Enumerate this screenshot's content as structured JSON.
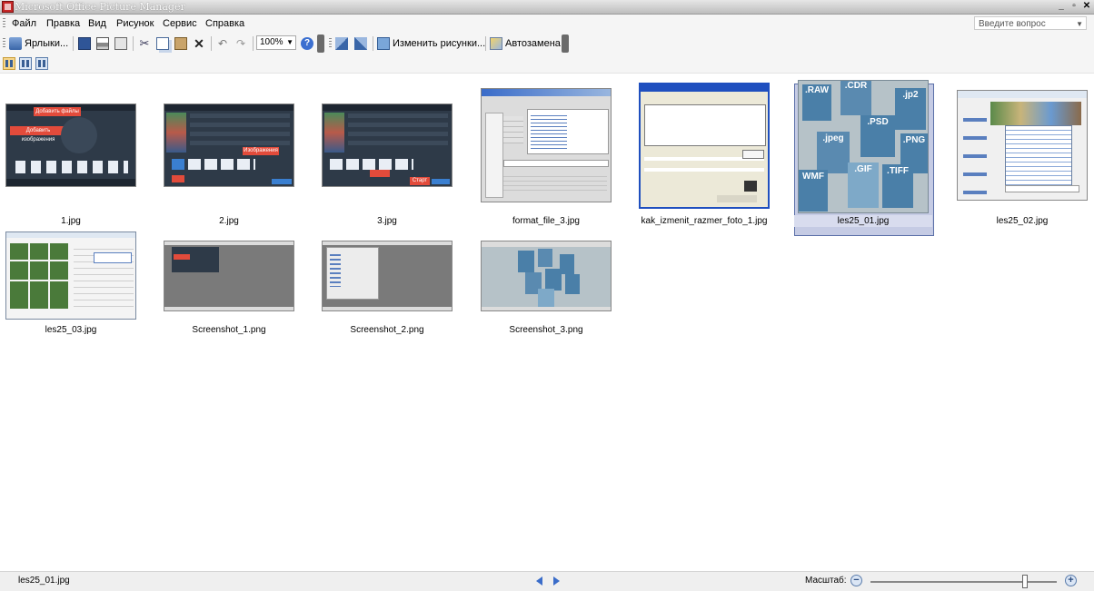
{
  "window": {
    "title": "Microsoft Office Picture Manager"
  },
  "menu": {
    "items": [
      "Файл",
      "Правка",
      "Вид",
      "Рисунок",
      "Сервис",
      "Справка"
    ]
  },
  "help": {
    "placeholder": "Введите вопрос"
  },
  "toolbar": {
    "shortcuts_label": "Ярлыки...",
    "zoom_value": "100%",
    "edit_pictures_label": "Изменить рисунки...",
    "autocorrect_label": "Автозамена"
  },
  "gallery": {
    "thumbnails": [
      {
        "filename": "1.jpg"
      },
      {
        "filename": "2.jpg"
      },
      {
        "filename": "3.jpg"
      },
      {
        "filename": "format_file_3.jpg"
      },
      {
        "filename": "kak_izmenit_razmer_foto_1.jpg"
      },
      {
        "filename": "les25_01.jpg",
        "selected": true
      },
      {
        "filename": "les25_02.jpg"
      },
      {
        "filename": "les25_03.jpg"
      },
      {
        "filename": "Screenshot_1.png"
      },
      {
        "filename": "Screenshot_2.png"
      },
      {
        "filename": "Screenshot_3.png"
      }
    ],
    "format_tags": [
      ".RAW",
      ".CDR",
      ".jp2",
      ".PSD",
      ".jpeg",
      ".PNG",
      "WMF",
      ".GIF",
      ".TIFF"
    ],
    "thumb_texts": {
      "t1_a": "Добавить файлы",
      "t1_b": "Добавить изображения",
      "t2_a": "Изображения",
      "t3_a": "Старт"
    }
  },
  "status": {
    "current_file": "les25_01.jpg",
    "zoom_label": "Масштаб:",
    "zoom_level_fraction": 0.83
  }
}
